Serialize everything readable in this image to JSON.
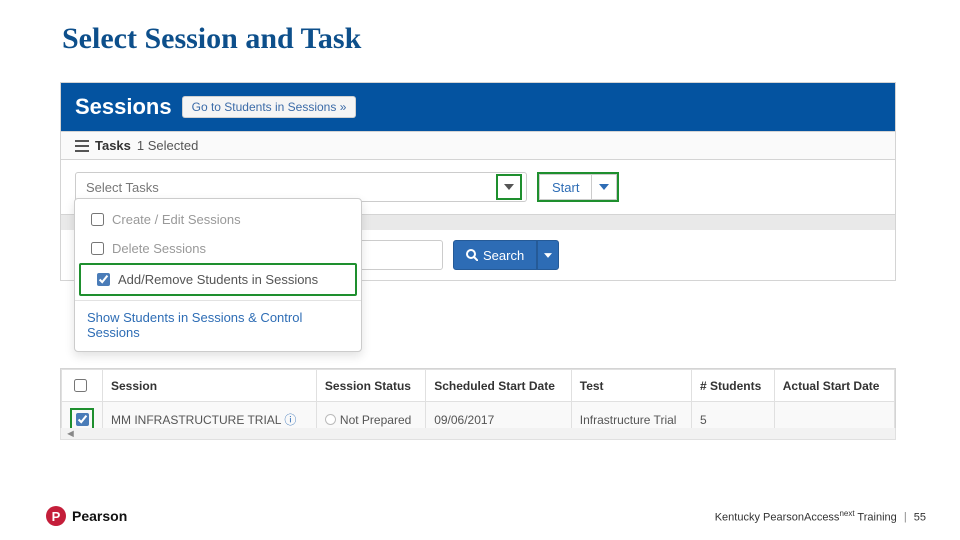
{
  "slide": {
    "title": "Select Session and Task"
  },
  "header": {
    "sessions_label": "Sessions",
    "students_link": "Go to Students in Sessions »"
  },
  "tasks": {
    "label": "Tasks",
    "selected_text": "1 Selected",
    "select_placeholder": "Select Tasks",
    "start_label": "Start"
  },
  "dropdown": {
    "items": [
      {
        "label": "Create / Edit Sessions",
        "checked": false
      },
      {
        "label": "Delete Sessions",
        "checked": false
      },
      {
        "label": "Add/Remove Students in Sessions",
        "checked": true
      }
    ],
    "link": "Show Students in Sessions & Control Sessions"
  },
  "search": {
    "button": "Search"
  },
  "grid": {
    "headers": {
      "session": "Session",
      "status": "Session Status",
      "scheduled": "Scheduled Start Date",
      "test": "Test",
      "students": "# Students",
      "actual": "Actual Start Date"
    },
    "row": {
      "checked": true,
      "session": "MM INFRASTRUCTURE TRIAL",
      "status": "Not Prepared",
      "scheduled": "09/06/2017",
      "test": "Infrastructure Trial",
      "students": "5",
      "actual": ""
    }
  },
  "footer": {
    "brand": "Pearson",
    "badge": "P",
    "text_a": "Kentucky PearsonAccess",
    "text_sup": "next",
    "text_b": " Training",
    "page": "55"
  }
}
